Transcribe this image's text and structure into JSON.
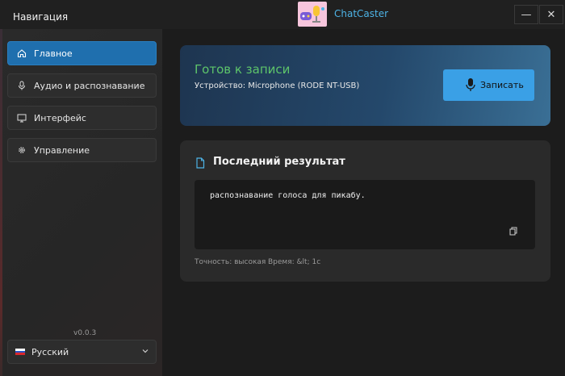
{
  "titlebar": {
    "nav_title": "Навигация",
    "app_name": "ChatCaster",
    "minimize_symbol": "—",
    "close_symbol": "✕"
  },
  "sidebar": {
    "items": [
      {
        "label": "Главное",
        "icon": "home-icon",
        "active": true
      },
      {
        "label": "Аудио и распознавание",
        "icon": "microphone-icon",
        "active": false
      },
      {
        "label": "Интерфейс",
        "icon": "monitor-icon",
        "active": false
      },
      {
        "label": "Управление",
        "icon": "gear-icon",
        "active": false
      }
    ],
    "version": "v0.0.3",
    "language": "Русский"
  },
  "record": {
    "status": "Готов к записи",
    "device": "Устройство: Microphone (RODE NT-USB)",
    "button_label": "Записать"
  },
  "result": {
    "title": "Последний результат",
    "text": "распознавание голоса для пикабу.",
    "accuracy": "Точность: высокая",
    "time": "Время: &lt; 1с"
  },
  "colors": {
    "accent": "#1f6fae",
    "status_green": "#5dc46a",
    "record_button": "#3aa0e6",
    "app_title": "#4db3e6"
  }
}
